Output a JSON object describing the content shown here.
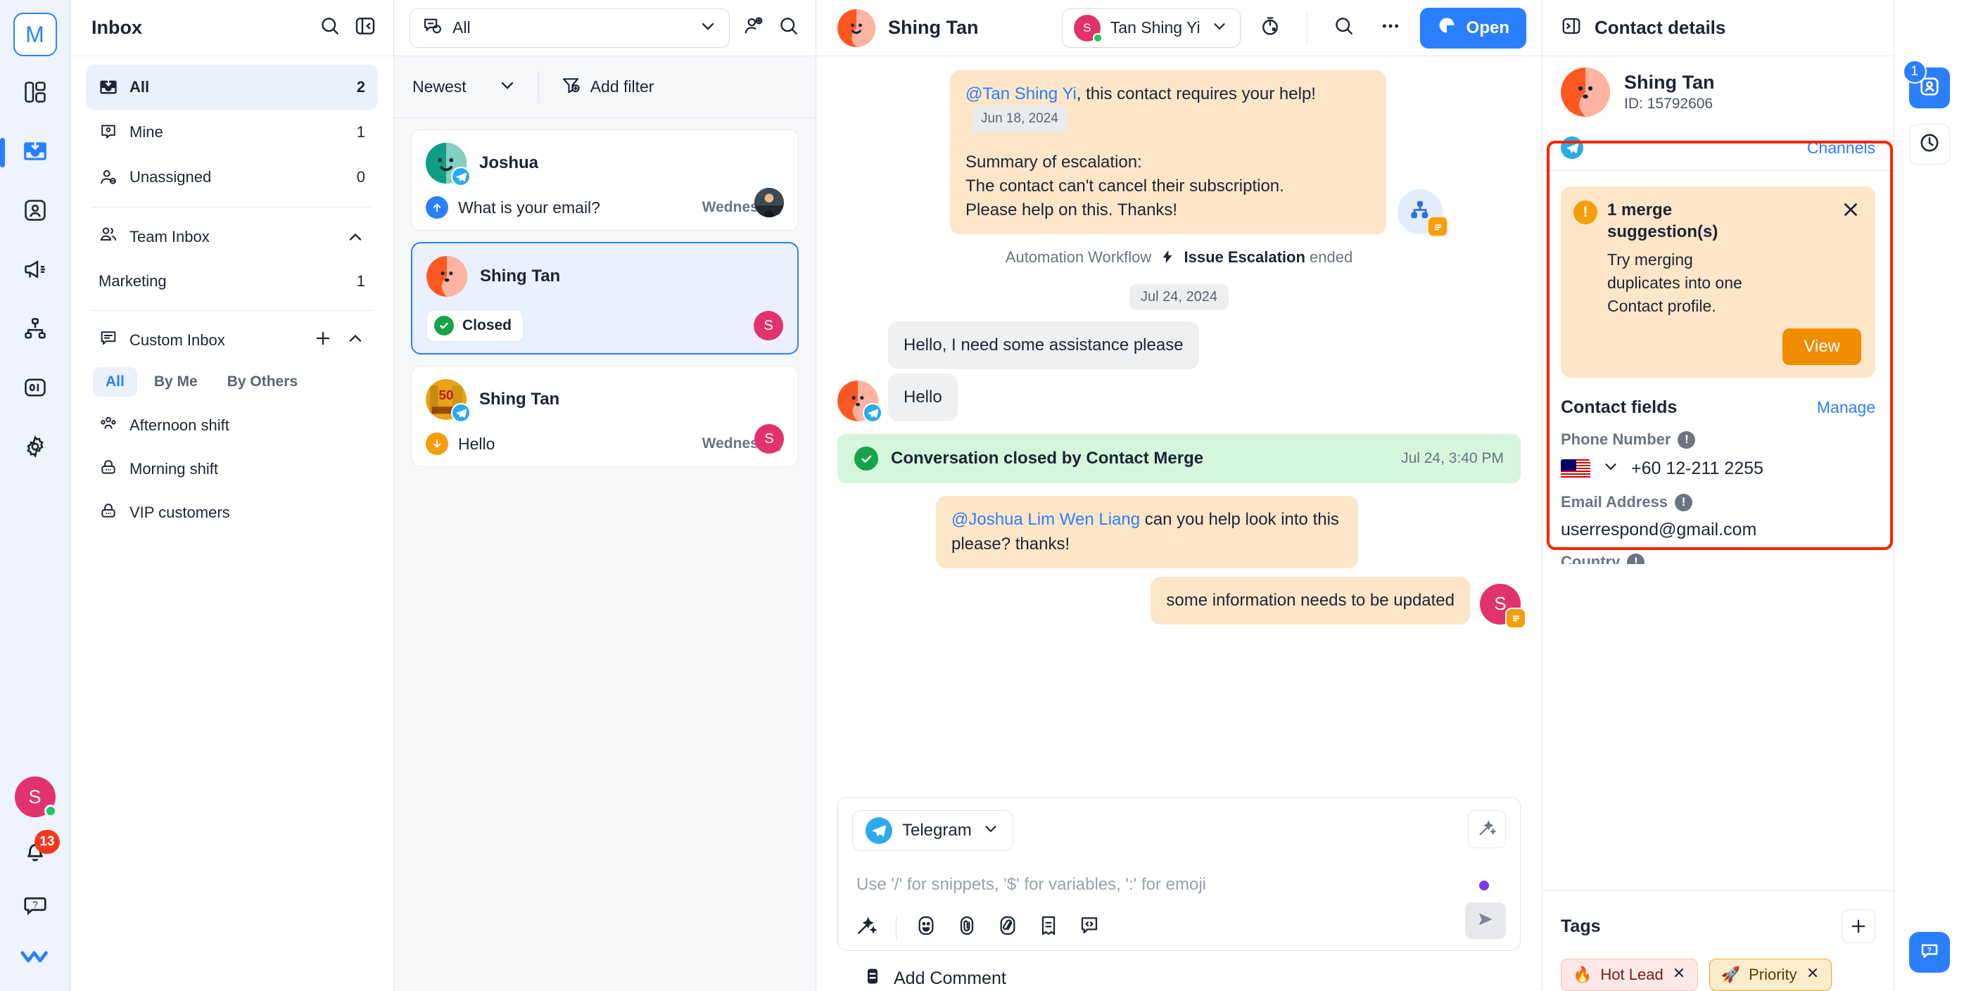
{
  "rail": {
    "logo_label": "M",
    "items": [
      {
        "name": "dashboard",
        "icon": "layout-icon"
      },
      {
        "name": "inbox",
        "icon": "inbox-icon",
        "active": true
      },
      {
        "name": "contacts",
        "icon": "contact-card-icon"
      },
      {
        "name": "broadcasts",
        "icon": "megaphone-icon"
      },
      {
        "name": "workflows",
        "icon": "workflow-icon"
      },
      {
        "name": "reports",
        "icon": "reports-icon"
      },
      {
        "name": "settings",
        "icon": "gear-icon"
      }
    ],
    "avatar_initial": "S",
    "notification_count": "13",
    "help_icon": "help-icon",
    "brand_icon": "double-check-icon"
  },
  "sidebar": {
    "title": "Inbox",
    "search_icon": "search-icon",
    "collapse_icon": "collapse-panel-icon",
    "primary": [
      {
        "label": "All",
        "count": "2",
        "icon": "inbox-icon",
        "active": true
      },
      {
        "label": "Mine",
        "count": "1",
        "icon": "person-card-icon",
        "active": false
      },
      {
        "label": "Unassigned",
        "count": "0",
        "icon": "person-minus-icon",
        "active": false
      }
    ],
    "team_inbox": {
      "label": "Team Inbox",
      "icon": "people-icon",
      "chevron": "chevron-up-icon"
    },
    "team_items": [
      {
        "label": "Marketing",
        "count": "1"
      }
    ],
    "custom_inbox": {
      "label": "Custom Inbox",
      "icon": "comment-lines-icon",
      "add": "plus-icon",
      "chevron": "chevron-up-icon"
    },
    "segments": [
      {
        "label": "All",
        "on": true
      },
      {
        "label": "By Me",
        "on": false
      },
      {
        "label": "By Others",
        "on": false
      }
    ],
    "custom_items": [
      {
        "label": "Afternoon shift",
        "icon": "group-icon"
      },
      {
        "label": "Morning shift",
        "icon": "lock-icon"
      },
      {
        "label": "VIP customers",
        "icon": "lock-icon"
      }
    ]
  },
  "conversation_list": {
    "filter_label": "All",
    "filter_icon": "conversation-filter-icon",
    "chevron_icon": "chevron-down-icon",
    "add_contact_icon": "add-contact-icon",
    "search_icon": "search-icon",
    "sort_label": "Newest",
    "sort_chevron": "chevron-down-icon",
    "add_filter_label": "Add filter",
    "add_filter_icon": "filter-plus-icon",
    "items": [
      {
        "name": "Joshua",
        "preview": "What is your email?",
        "time": "Wednesday",
        "direction": "outgoing",
        "channel": "telegram",
        "avatar_color": "#0f9e85",
        "assignee_avatar": "photo",
        "selected": false,
        "status": null
      },
      {
        "name": "Shing Tan",
        "preview": null,
        "time": null,
        "direction": null,
        "channel": null,
        "avatar_color": "#ff5722",
        "assignee_initial": "S",
        "selected": true,
        "status": "Closed"
      },
      {
        "name": "Shing Tan",
        "preview": "Hello",
        "time": "Wednesday",
        "direction": "incoming",
        "channel": "telegram",
        "avatar_color": "#e8a317",
        "assignee_initial": "S",
        "selected": false,
        "status": null
      }
    ]
  },
  "message_pane": {
    "contact_name": "Shing Tan",
    "assignee_name": "Tan Shing Yi",
    "assignee_initial": "S",
    "assignee_chevron": "chevron-down-icon",
    "snooze_icon": "timer-icon",
    "search_icon": "search-icon",
    "more_icon": "ellipsis-icon",
    "open_button_label": "Open",
    "open_button_icon": "open-status-icon",
    "messages": [
      {
        "type": "note",
        "side": "left",
        "mention": "@Tan Shing Yi",
        "text": ", this contact requires your help!",
        "inline_date": "Jun 18, 2024",
        "text2_line1": "Summary of escalation:",
        "text2_line2": "The contact can't cancel their subscription.",
        "text2_line3": "Please help on this. Thanks!",
        "badge_icon": "workflow-icon"
      },
      {
        "type": "system",
        "prefix": "Automation Workflow",
        "bold": "Issue Escalation",
        "suffix": "ended",
        "icon": "lightning-icon"
      },
      {
        "type": "date",
        "label": "Jul 24, 2024"
      },
      {
        "type": "incoming",
        "text": "Hello, I need some assistance please"
      },
      {
        "type": "incoming",
        "text": "Hello",
        "avatar": true,
        "channel": "telegram"
      },
      {
        "type": "closed",
        "text_prefix": "Conversation closed by",
        "text_bold": "Contact Merge",
        "time": "Jul 24, 3:40 PM",
        "icon": "check-circle-icon"
      },
      {
        "type": "note",
        "side": "left",
        "mention": "@Joshua Lim Wen Liang",
        "text": " can you help look into this please? thanks!"
      },
      {
        "type": "note",
        "side": "right",
        "text": "some information needs to be updated",
        "avatar_initial": "S"
      }
    ],
    "composer": {
      "channel_label": "Telegram",
      "channel_icon": "telegram-icon",
      "channel_chevron": "chevron-down-icon",
      "magic_icon": "ai-wand-icon",
      "placeholder": "Use '/' for snippets, '$' for variables, ':' for emoji",
      "tools": [
        {
          "icon": "ai-wand-icon",
          "name": "ai-assist"
        },
        {
          "icon": "emoji-icon",
          "name": "emoji"
        },
        {
          "icon": "attachment-icon",
          "name": "attachment"
        },
        {
          "icon": "snippet-icon",
          "name": "snippet"
        },
        {
          "icon": "note-icon",
          "name": "template"
        },
        {
          "icon": "variable-icon",
          "name": "variable"
        }
      ],
      "send_icon": "send-icon"
    },
    "add_comment_label": "Add Comment",
    "add_comment_icon": "comment-icon"
  },
  "contact_panel": {
    "title": "Contact details",
    "expand_icon": "expand-panel-icon",
    "contact_name": "Shing Tan",
    "contact_id": "ID: 15792606",
    "channels_link": "Channels",
    "channel_icon": "telegram-icon",
    "merge_card": {
      "title": "1 merge suggestion(s)",
      "body": "Try merging duplicates into one Contact profile.",
      "button_label": "View",
      "warn_icon": "warning-icon",
      "close_icon": "close-icon"
    },
    "fields_title": "Contact fields",
    "manage_link": "Manage",
    "fields": [
      {
        "label": "Phone Number",
        "value": "+60 12-211 2255",
        "type": "phone",
        "flag": "malaysia-flag",
        "chevron": "chevron-down-icon"
      },
      {
        "label": "Email Address",
        "value": "userrespond@gmail.com",
        "type": "text"
      },
      {
        "label": "Country",
        "value": "",
        "type": "text"
      }
    ],
    "tags_title": "Tags",
    "tags_add_icon": "plus-icon",
    "tags": [
      {
        "emoji": "🔥",
        "label": "Hot Lead",
        "style": "hot",
        "remove_icon": "close-icon"
      },
      {
        "emoji": "🚀",
        "label": "Priority",
        "style": "pri",
        "remove_icon": "close-icon"
      }
    ]
  },
  "mini_rail": {
    "contact_badge_count": "1",
    "contact_icon": "contact-card-icon",
    "history_icon": "clock-icon",
    "chat_fab_icon": "chat-help-icon"
  }
}
